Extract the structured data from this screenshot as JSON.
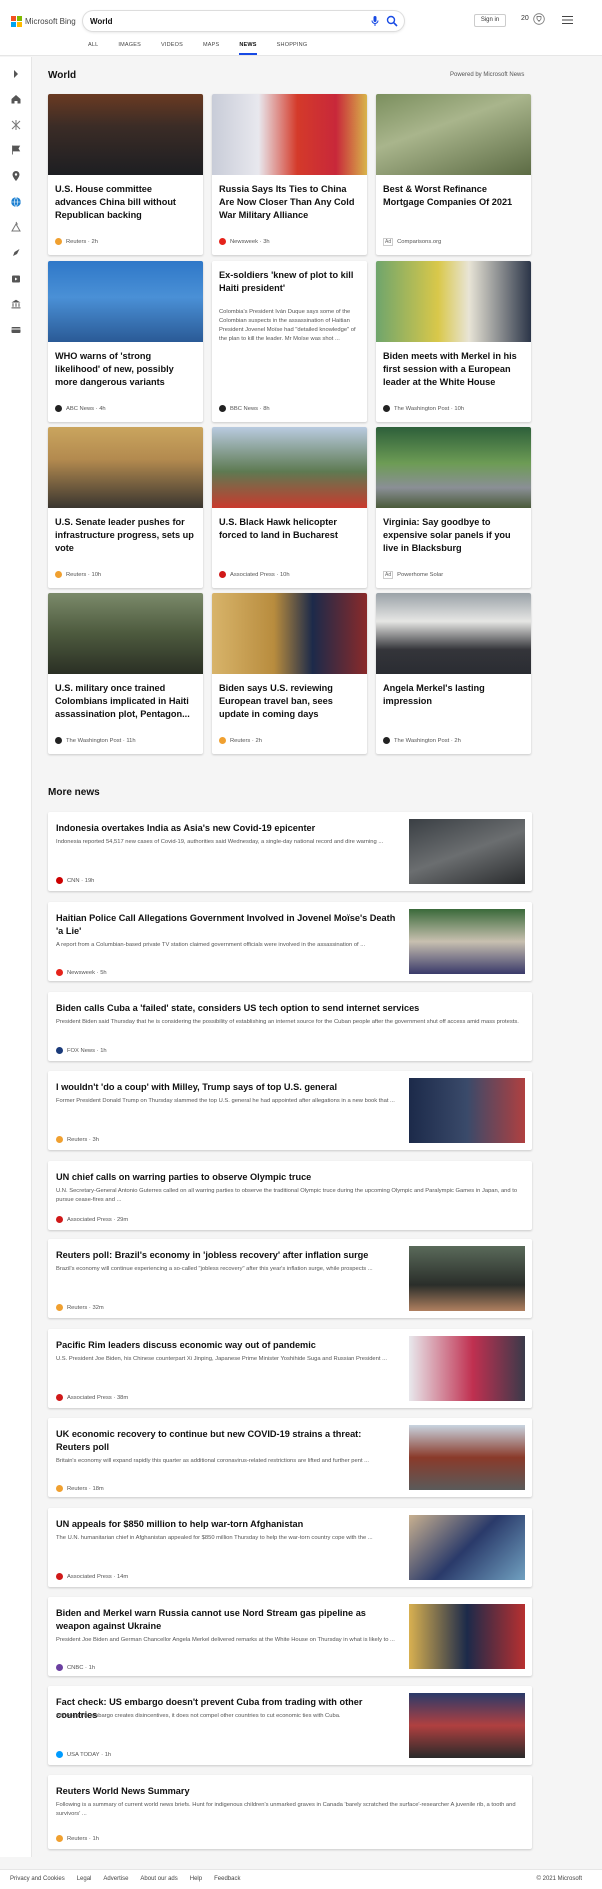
{
  "header": {
    "brand": "Microsoft Bing",
    "search_value": "World",
    "signin_label": "Sign in",
    "rewards_count": "20",
    "logo_colors": [
      "#f25022",
      "#7fba00",
      "#00a4ef",
      "#ffb900"
    ]
  },
  "nav": {
    "tabs": [
      {
        "label": "ALL"
      },
      {
        "label": "IMAGES"
      },
      {
        "label": "VIDEOS"
      },
      {
        "label": "MAPS"
      },
      {
        "label": "NEWS"
      },
      {
        "label": "SHOPPING"
      }
    ],
    "active": "NEWS"
  },
  "rail": {
    "icons": [
      "chevron-right-icon",
      "home-icon",
      "sports-icon",
      "flag-icon",
      "location-icon",
      "globe-icon",
      "science-icon",
      "rocket-icon",
      "entertainment-icon",
      "bank-icon",
      "money-icon"
    ]
  },
  "section": {
    "title": "World",
    "powered": "Powered by Microsoft News"
  },
  "cards": [
    {
      "title": "U.S. House committee advances China bill without Republican backing",
      "source": "Reuters",
      "time": "2h",
      "logo": "#f0a030"
    },
    {
      "title": "Russia Says Its Ties to China Are Now Closer Than Any Cold War Military Alliance",
      "source": "Newsweek",
      "time": "3h",
      "logo": "#e5231b"
    },
    {
      "title": "Best & Worst Refinance Mortgage Companies Of 2021",
      "source": "Comparisons.org",
      "ad": "Ad"
    },
    {
      "title": "WHO warns of 'strong likelihood' of new, possibly more dangerous variants",
      "source": "ABC News",
      "time": "4h",
      "logo": "#222"
    },
    {
      "title": "Ex-soldiers 'knew of plot to kill Haiti president'",
      "desc": "Colombia's President Iván Duque says some of the Colombian suspects in the assassination of Haitian President Jovenel Moïse had \"detailed knowledge\" of the plan to kill the leader. Mr Moïse was shot ...",
      "source": "BBC News",
      "time": "8h",
      "logo": "#222"
    },
    {
      "title": "Biden meets with Merkel in his first session with a European leader at the White House",
      "source": "The Washington Post",
      "time": "10h",
      "logo": "#222"
    },
    {
      "title": "U.S. Senate leader pushes for infrastructure progress, sets up vote",
      "source": "Reuters",
      "time": "10h",
      "logo": "#f0a030"
    },
    {
      "title": "U.S. Black Hawk helicopter forced to land in Bucharest",
      "source": "Associated Press",
      "time": "10h",
      "logo": "#d01919"
    },
    {
      "title": "Virginia: Say goodbye to expensive solar panels if you live in Blacksburg",
      "source": "Powerhome Solar",
      "ad": "Ad"
    },
    {
      "title": "U.S. military once trained Colombians implicated in Haiti assassination plot, Pentagon...",
      "source": "The Washington Post",
      "time": "11h",
      "logo": "#222"
    },
    {
      "title": "Biden says U.S. reviewing European travel ban, sees update in coming days",
      "source": "Reuters",
      "time": "2h",
      "logo": "#f0a030"
    },
    {
      "title": "Angela Merkel's lasting impression",
      "source": "The Washington Post",
      "time": "2h",
      "logo": "#222"
    }
  ],
  "more": {
    "title": "More news",
    "items": [
      {
        "title": "Indonesia overtakes India as Asia's new Covid-19 epicenter",
        "desc": "Indonesia reported 54,517 new cases of Covid-19, authorities said Wednesday, a single-day national record and dire warning ...",
        "source": "CNN",
        "time": "19h",
        "logo": "#cc0000"
      },
      {
        "title": "Haitian Police Call Allegations Government Involved in Jovenel Moïse's Death 'a Lie'",
        "desc": "A report from a Columbian-based private TV station claimed government officials were involved in the assassination of ...",
        "source": "Newsweek",
        "time": "5h",
        "logo": "#e5231b"
      },
      {
        "title": "Biden calls Cuba a 'failed' state, considers US tech option to send internet services",
        "desc": "President Biden said Thursday that he is considering the possibility of establishing an internet source for the Cuban people after the government shut off access amid mass protests.",
        "source": "FOX News",
        "time": "1h",
        "logo": "#1a3a7a"
      },
      {
        "title": "I wouldn't 'do a coup' with Milley, Trump says of top U.S. general",
        "desc": "Former President Donald Trump on Thursday slammed the top U.S. general he had appointed after allegations in a new book that ...",
        "source": "Reuters",
        "time": "3h",
        "logo": "#f0a030"
      },
      {
        "title": "UN chief calls on warring parties to observe Olympic truce",
        "desc": "U.N. Secretary-General Antonio Guterres called on all warring parties to observe the traditional Olympic truce during the upcoming Olympic and Paralympic Games in Japan, and to pursue cease-fires and ...",
        "source": "Associated Press",
        "time": "29m",
        "logo": "#d01919"
      },
      {
        "title": "Reuters poll: Brazil's economy in 'jobless recovery' after inflation surge",
        "desc": "Brazil's economy will continue experiencing a so-called \"jobless recovery\" after this year's inflation surge, while prospects ...",
        "source": "Reuters",
        "time": "32m",
        "logo": "#f0a030"
      },
      {
        "title": "Pacific Rim leaders discuss economic way out of pandemic",
        "desc": "U.S. President Joe Biden, his Chinese counterpart Xi Jinping, Japanese Prime Minister Yoshihide Suga and Russian President ...",
        "source": "Associated Press",
        "time": "38m",
        "logo": "#d01919"
      },
      {
        "title": "UK economic recovery to continue but new COVID-19 strains a threat: Reuters poll",
        "desc": "Britain's economy will expand rapidly this quarter as additional coronavirus-related restrictions are lifted and further pent ...",
        "source": "Reuters",
        "time": "18m",
        "logo": "#f0a030"
      },
      {
        "title": "UN appeals for $850 million to help war-torn Afghanistan",
        "desc": "The U.N. humanitarian chief in Afghanistan appealed for $850 million Thursday to help the war-torn country cope with the ...",
        "source": "Associated Press",
        "time": "14m",
        "logo": "#d01919"
      },
      {
        "title": "Biden and Merkel warn Russia cannot use Nord Stream gas pipeline as weapon against Ukraine",
        "desc": "President Joe Biden and German Chancellor Angela Merkel delivered remarks at the White House on Thursday in what is likely to ...",
        "source": "CNBC",
        "time": "1h",
        "logo": "#6b3fa0"
      },
      {
        "title": "Fact check: US embargo doesn't prevent Cuba from trading with other countries",
        "desc": "Although the embargo creates disincentives, it does not compel other countries to cut economic ties with Cuba.",
        "source": "USA TODAY",
        "time": "1h",
        "logo": "#009bff"
      },
      {
        "title": "Reuters World News Summary",
        "desc": "Following is a summary of current world news briefs. Hunt for indigenous children's unmarked graves in Canada 'barely scratched the surface'-researcher A juvenile rib, a tooth and survivors' ...",
        "source": "Reuters",
        "time": "1h",
        "logo": "#f0a030"
      }
    ]
  },
  "footer": {
    "links": [
      "Privacy and Cookies",
      "Legal",
      "Advertise",
      "About our ads",
      "Help",
      "Feedback"
    ],
    "copyright": "© 2021 Microsoft"
  }
}
